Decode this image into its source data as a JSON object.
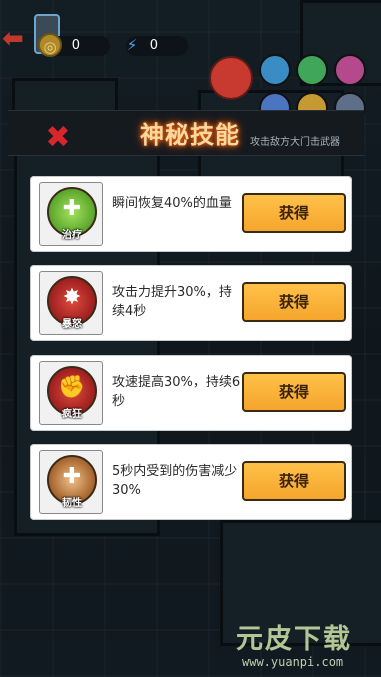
{
  "hud": {
    "coins": "0",
    "energy": "0"
  },
  "banner": {
    "title": "神秘技能",
    "hint": "攻击敌方大门击武器"
  },
  "skills": [
    {
      "name": "heal",
      "badge": "治疗",
      "description": "瞬间恢复40%的血量",
      "button": "获得",
      "color": "#6bb83a"
    },
    {
      "name": "rage",
      "badge": "暴怒",
      "description": "攻击力提升30%，持续4秒",
      "button": "获得",
      "color": "#a3262b"
    },
    {
      "name": "frenzy",
      "badge": "疯狂",
      "description": "攻速提高30%，持续6秒",
      "button": "获得",
      "color": "#a3262b"
    },
    {
      "name": "toughness",
      "badge": "韧性",
      "description": "5秒内受到的伤害减少30%",
      "button": "获得",
      "color": "#7a4a1e"
    }
  ],
  "watermark": {
    "brand": "元皮下载",
    "url": "www.yuanpi.com"
  }
}
